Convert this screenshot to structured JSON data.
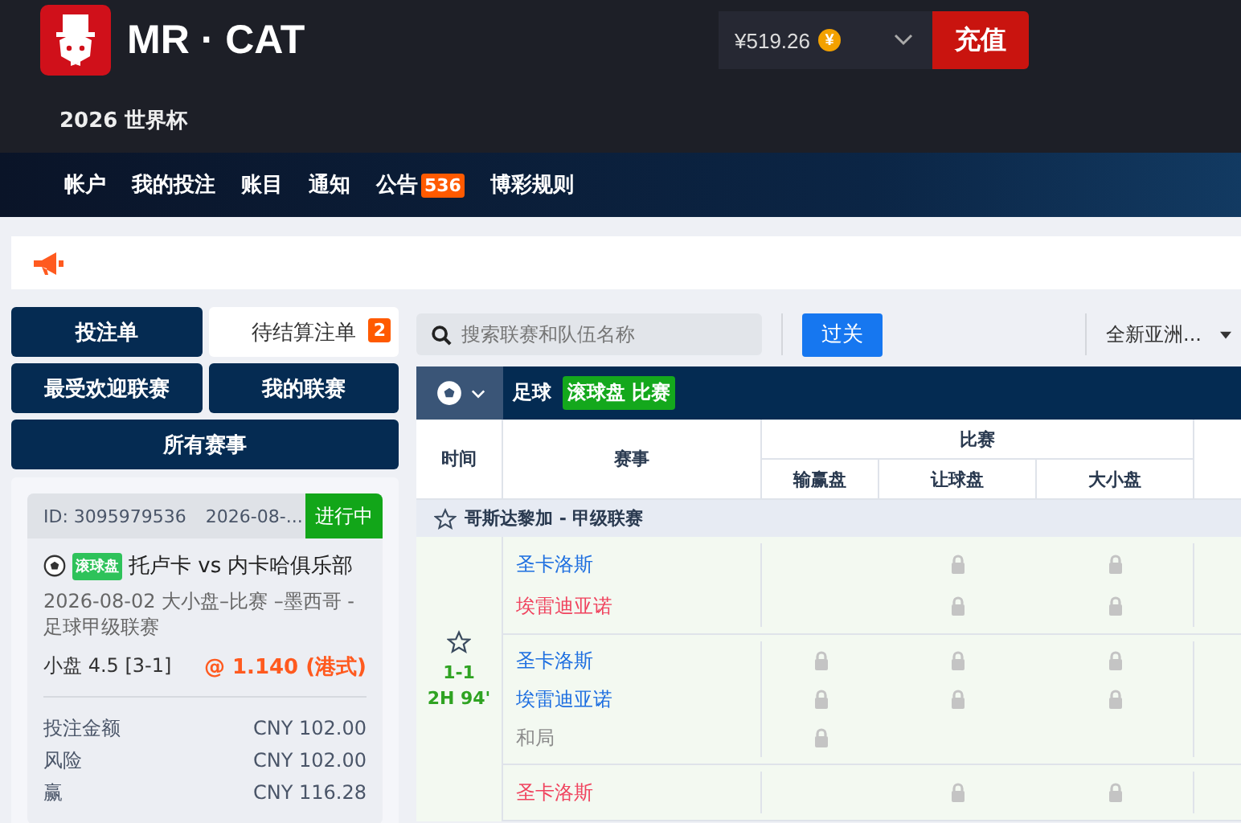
{
  "header": {
    "brand": "MR · CAT",
    "balance": "¥519.26",
    "coin": "¥",
    "deposit": "充值",
    "subtitle": "2026 世界杯"
  },
  "nav": [
    {
      "label": "帐户"
    },
    {
      "label": "我的投注"
    },
    {
      "label": "账目"
    },
    {
      "label": "通知"
    },
    {
      "label": "公告",
      "badge": "536"
    },
    {
      "label": "博彩规则"
    }
  ],
  "tabs": [
    {
      "label": "投注单",
      "selected": false
    },
    {
      "label": "待结算注单",
      "selected": true,
      "badge": "2"
    },
    {
      "label": "最受欢迎联赛",
      "selected": false
    },
    {
      "label": "我的联赛",
      "selected": false
    },
    {
      "label": "所有赛事",
      "selected": false
    }
  ],
  "bet": {
    "id": "ID: 3095979536",
    "date": "2026-08-...",
    "status": "进行中",
    "tag": "滚球盘",
    "match": "托卢卡 vs 内卡哈俱乐部",
    "desc": "2026-08-02 大小盘–比赛 –墨西哥 - 足球甲级联赛",
    "selection": "小盘 4.5 [3-1]",
    "odds": "@ 1.140 (港式)",
    "amounts": [
      {
        "label": "投注金额",
        "value": "CNY 102.00"
      },
      {
        "label": "风险",
        "value": "CNY 102.00"
      },
      {
        "label": "赢",
        "value": "CNY 116.28"
      }
    ]
  },
  "search": {
    "placeholder": "搜索联赛和队伍名称"
  },
  "parlay_button": "过关",
  "odds_type": "全新亚洲...",
  "sport_bar": {
    "sport": "足球",
    "tag": "滚球盘 比赛"
  },
  "table": {
    "col_time": "时间",
    "col_event": "赛事",
    "group": "比赛",
    "markets": [
      "输赢盘",
      "让球盘",
      "大小盘"
    ],
    "league": {
      "name": "哥斯达黎加 - 甲级联赛",
      "starred": false
    },
    "match": {
      "starred": false,
      "score": "1-1",
      "clock": "2H 94'"
    },
    "games": [
      {
        "lines": [
          {
            "team": "圣卡洛斯",
            "color": "#1e6fe0",
            "locked": [
              false,
              true,
              true
            ]
          },
          {
            "team": "埃雷迪亚诺",
            "color": "#f0435e",
            "locked": [
              false,
              true,
              true
            ]
          }
        ]
      },
      {
        "lines": [
          {
            "team": "圣卡洛斯",
            "color": "#1e6fe0",
            "locked": [
              true,
              true,
              true
            ]
          },
          {
            "team": "埃雷迪亚诺",
            "color": "#1e6fe0",
            "locked": [
              true,
              true,
              true
            ]
          },
          {
            "team": "和局",
            "color": "#8c8c8c",
            "locked": [
              true,
              false,
              false
            ]
          }
        ]
      },
      {
        "lines": [
          {
            "team": "圣卡洛斯",
            "color": "#f0435e",
            "locked": [
              false,
              true,
              true
            ]
          }
        ]
      }
    ]
  }
}
